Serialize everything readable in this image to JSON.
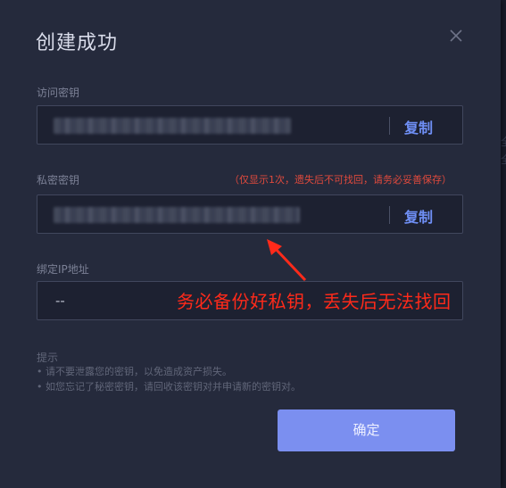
{
  "dialog": {
    "title": "创建成功",
    "close_icon": "close-icon"
  },
  "access_key": {
    "label": "访问密钥",
    "copy_label": "复制"
  },
  "secret_key": {
    "label": "私密密钥",
    "warning": "（仅显示1次，遗失后不可找回，请务必妥善保存）",
    "copy_label": "复制"
  },
  "ip_binding": {
    "label": "绑定IP地址",
    "value": "--"
  },
  "annotation": {
    "text": "务必备份好私钥，丢失后无法找回",
    "color": "#ff2a1a"
  },
  "tips": {
    "title": "提示",
    "items": [
      "• 请不要泄露您的密钥，以免造成资产损失。",
      "• 如您忘记了秘密密钥，请回收该密钥对并申请新的密钥对。"
    ]
  },
  "confirm_label": "确定",
  "colors": {
    "accent": "#7b8ff0",
    "link": "#6f8ff5",
    "warning": "#e04a3d",
    "dialog_bg": "#252a3c"
  }
}
